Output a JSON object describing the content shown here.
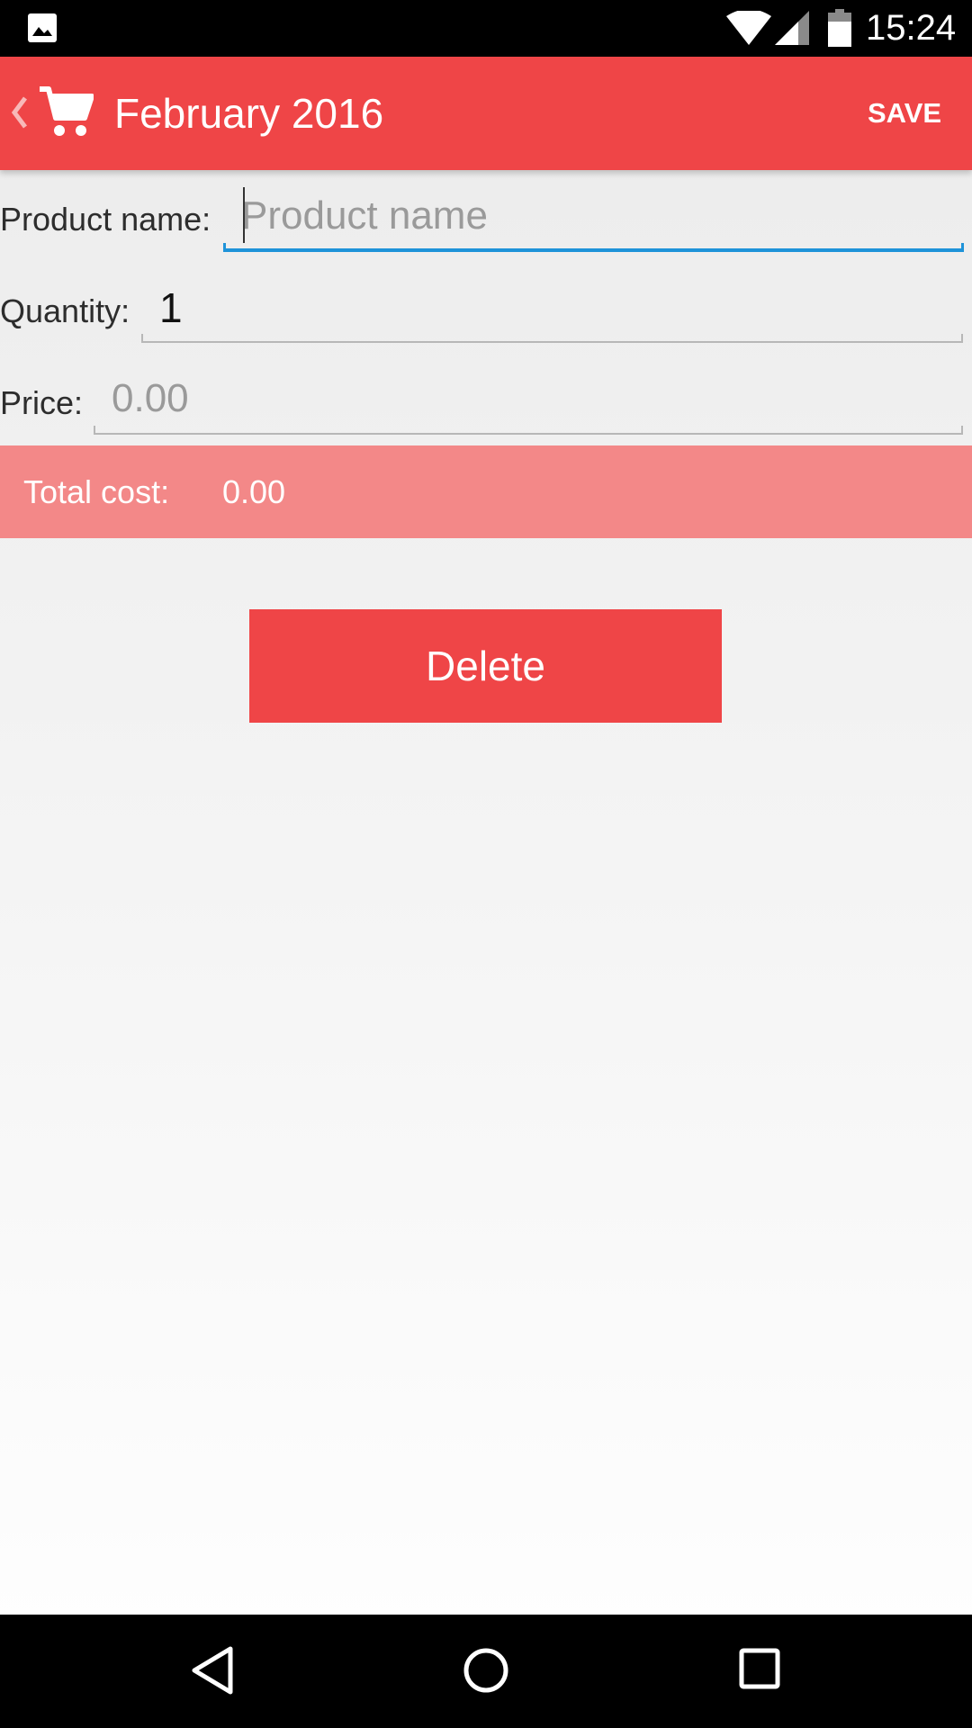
{
  "status_bar": {
    "time": "15:24",
    "icons": [
      "gallery-icon",
      "wifi-icon",
      "signal-icon",
      "battery-icon"
    ]
  },
  "app_bar": {
    "title": "February 2016",
    "save_label": "SAVE",
    "background_color": "#ef4547",
    "icons": [
      "back-icon",
      "cart-icon"
    ]
  },
  "form": {
    "product_name": {
      "label": "Product name:",
      "value": "",
      "placeholder": "Product name",
      "focused": true
    },
    "quantity": {
      "label": "Quantity:",
      "value": "1",
      "placeholder": ""
    },
    "price": {
      "label": "Price:",
      "value": "",
      "placeholder": "0.00"
    }
  },
  "total": {
    "label": "Total cost:",
    "value": "0.00",
    "background_color": "#f38888"
  },
  "delete_button": {
    "label": "Delete"
  },
  "nav_bar": {
    "icons": [
      "back-triangle-icon",
      "home-circle-icon",
      "recents-square-icon"
    ]
  },
  "colors": {
    "accent": "#ef4547",
    "focus_underline": "#1e93d9"
  }
}
